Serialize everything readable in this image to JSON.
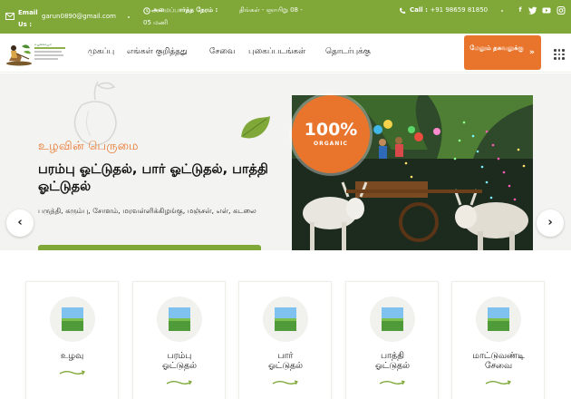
{
  "topbar": {
    "email_label": "Email Us :",
    "email": "garun0890@gmail.com",
    "hours_label": "அமைப்பார்த்த நேரம் :",
    "hours_days": "திங்கள் - ஞாயிறு 08 -",
    "hours_time": "05 மணி",
    "call_label": "Call :",
    "call_number": "+91 98659 81850",
    "social": [
      "facebook-icon",
      "twitter-icon",
      "youtube-icon",
      "instagram-icon"
    ],
    "color": "#7fa839"
  },
  "nav": {
    "logo_text": "உழவிசாயம்",
    "items": [
      "முகப்பு",
      "எங்கள் குறித்தது",
      "சேவை",
      "புகைப்படங்கள்",
      "தொடர்புக்கு"
    ],
    "cta_label": "மேலும் தகவலுக்கு",
    "cta_arrow": "»",
    "accent": "#e9752d"
  },
  "hero": {
    "eyebrow": "உழவின் பெருமை",
    "title": "பரம்பு ஓட்டுதல், பார் ஓட்டுதல், பாத்தி ஓட்டுதல்",
    "description": "பருத்தி, கரும்பு, சோளம், மரவள்ளிக்கிழங்கு, மஞ்சள், எள், கடலை",
    "badge_main": "100%",
    "badge_sub": "ORGANIC",
    "prev": "‹",
    "next": "›"
  },
  "services": [
    {
      "label": "உழவு"
    },
    {
      "label": "பரம்பு ஓட்டுதல்"
    },
    {
      "label": "பார் ஓட்டுதல்"
    },
    {
      "label": "பாத்தி ஓட்டுதல்"
    },
    {
      "label": "மாட்டுவண்டி சேவை"
    }
  ]
}
